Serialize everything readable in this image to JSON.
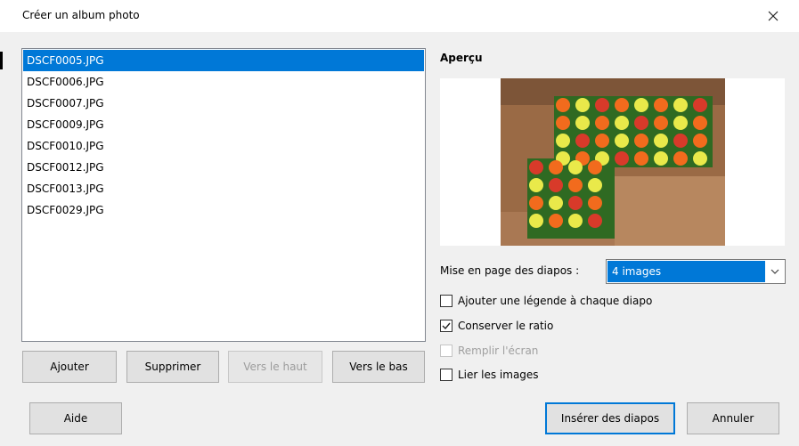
{
  "window": {
    "title": "Créer un album photo"
  },
  "files": [
    {
      "name": "DSCF0005.JPG",
      "selected": true
    },
    {
      "name": "DSCF0006.JPG"
    },
    {
      "name": "DSCF0007.JPG"
    },
    {
      "name": "DSCF0009.JPG"
    },
    {
      "name": "DSCF0010.JPG"
    },
    {
      "name": "DSCF0012.JPG"
    },
    {
      "name": "DSCF0013.JPG"
    },
    {
      "name": "DSCF0029.JPG"
    }
  ],
  "list_buttons": {
    "add": "Ajouter",
    "remove": "Supprimer",
    "up": "Vers le haut",
    "down": "Vers le bas"
  },
  "preview": {
    "label": "Aperçu"
  },
  "options": {
    "layout_label": "Mise en page des diapos :",
    "layout_value": "4 images",
    "caption_label": "Ajouter une légende à chaque diapo",
    "caption_checked": false,
    "ratio_label": "Conserver le ratio",
    "ratio_checked": true,
    "fill_label": "Remplir l'écran",
    "fill_enabled": false,
    "link_label": "Lier les images",
    "link_checked": false
  },
  "footer": {
    "help": "Aide",
    "insert": "Insérer des diapos",
    "cancel": "Annuler"
  },
  "colors": {
    "accent": "#0078d7",
    "background": "#f0f0f0"
  },
  "icons": {
    "close": "close-icon",
    "dropdown": "chevron-down-icon",
    "check": "check-icon"
  }
}
